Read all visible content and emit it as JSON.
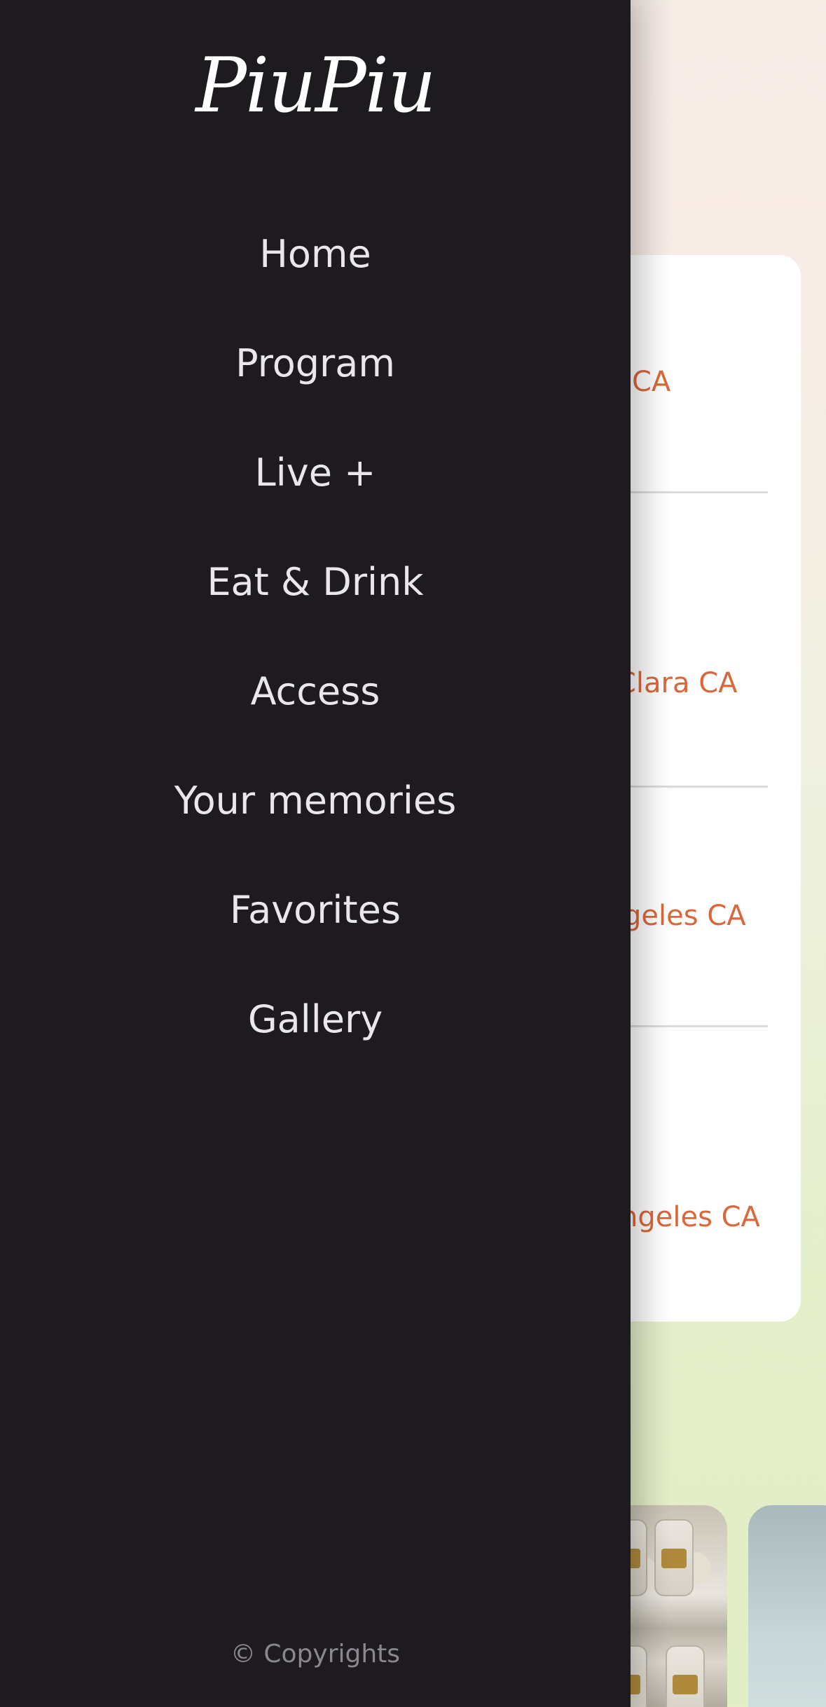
{
  "drawer": {
    "logo": "PiuPiu",
    "nav": [
      {
        "label": "Home"
      },
      {
        "label": "Program"
      },
      {
        "label": "Live +"
      },
      {
        "label": "Eat & Drink"
      },
      {
        "label": "Access"
      },
      {
        "label": "Your memories"
      },
      {
        "label": "Favorites"
      },
      {
        "label": "Gallery"
      }
    ],
    "copyright": "© Copyrights"
  },
  "background": {
    "locations": [
      {
        "text": "CA"
      },
      {
        "text": "Clara CA"
      },
      {
        "text": "geles CA"
      },
      {
        "text": "ngeles CA"
      }
    ]
  },
  "colors": {
    "drawer_bg": "#1e1b20",
    "accent": "#d9683c"
  }
}
